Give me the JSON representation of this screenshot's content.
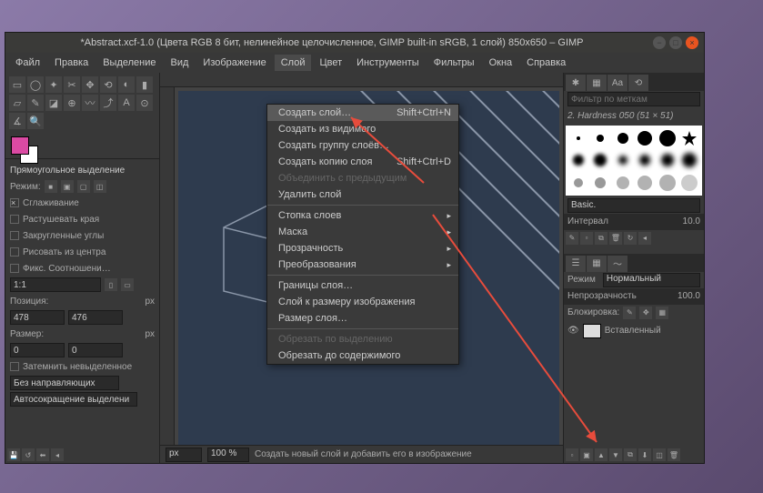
{
  "titlebar": {
    "title": "*Abstract.xcf-1.0 (Цвета RGB 8 бит, нелинейное целочисленное, GIMP built-in sRGB, 1 слой) 850x650 – GIMP"
  },
  "menubar": {
    "items": [
      "Файл",
      "Правка",
      "Выделение",
      "Вид",
      "Изображение",
      "Слой",
      "Цвет",
      "Инструменты",
      "Фильтры",
      "Окна",
      "Справка"
    ]
  },
  "dropdown": {
    "items": [
      {
        "label": "Создать слой…",
        "shortcut": "Shift+Ctrl+N",
        "highlight": true
      },
      {
        "label": "Создать из видимого"
      },
      {
        "label": "Создать группу слоёв…"
      },
      {
        "label": "Создать копию слоя",
        "shortcut": "Shift+Ctrl+D"
      },
      {
        "label": "Объединить с предыдущим",
        "disabled": true
      },
      {
        "label": "Удалить слой"
      },
      {
        "sep": true
      },
      {
        "label": "Стопка слоев",
        "sub": true
      },
      {
        "label": "Маска",
        "sub": true
      },
      {
        "label": "Прозрачность",
        "sub": true
      },
      {
        "label": "Преобразования",
        "sub": true
      },
      {
        "sep": true
      },
      {
        "label": "Границы слоя…"
      },
      {
        "label": "Слой к размеру изображения"
      },
      {
        "label": "Размер слоя…"
      },
      {
        "sep": true
      },
      {
        "label": "Обрезать по выделению",
        "disabled": true
      },
      {
        "label": "Обрезать до содержимого"
      }
    ]
  },
  "leftpanel": {
    "section_title": "Прямоугольное выделение",
    "mode_label": "Режим:",
    "antialias": "Сглаживание",
    "feather": "Растушевать края",
    "rounded": "Закругленные углы",
    "center": "Рисовать из центра",
    "aspect": "Фикс. Соотношени…",
    "ratio": "1:1",
    "pos_label": "Позиция:",
    "pos_x": "478",
    "pos_y": "476",
    "size_label": "Размер:",
    "size_x": "0",
    "size_y": "0",
    "px": "px",
    "darken": "Затемнить невыделенное",
    "noguides": "Без направляющих",
    "autoshrink": "Автосокращение выделени"
  },
  "rightpanel": {
    "filter_label": "Фильтр по меткам",
    "brush_name": "2. Hardness 050 (51 × 51)",
    "basic": "Basic.",
    "interval_label": "Интервал",
    "interval_val": "10.0",
    "mode_label": "Режим",
    "mode_val": "Нормальный",
    "opacity_label": "Непрозрачность",
    "opacity_val": "100.0",
    "lock_label": "Блокировка:",
    "layer_name": "Вставленный"
  },
  "statusbar": {
    "unit": "px",
    "zoom": "100 %",
    "hint": "Создать новый слой и добавить его в изображение"
  }
}
